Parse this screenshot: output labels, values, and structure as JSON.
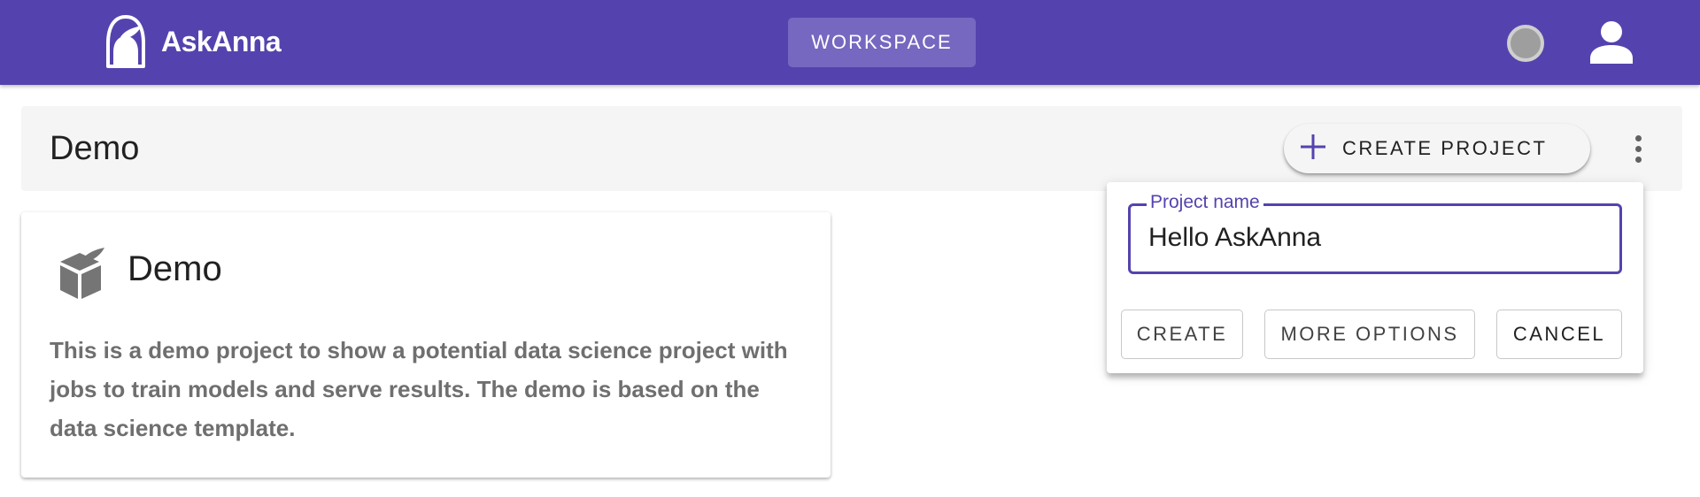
{
  "appbar": {
    "brand_name": "AskAnna",
    "workspace_label": "WORKSPACE",
    "logo_icon": "askanna-logo-icon",
    "status_icon": "status-circle-icon",
    "user_icon": "account-icon",
    "colors": {
      "primary": "#5443ae",
      "workspace_button": "#7668c0"
    }
  },
  "toolbar": {
    "title": "Demo",
    "create_project_label": "CREATE PROJECT",
    "create_icon": "plus-icon",
    "menu_icon": "dots-vertical-icon"
  },
  "project_card": {
    "icon": "cube-icon",
    "title": "Demo",
    "description": "This is a demo project to show a potential data science project with jobs to train models and serve results. The demo is based on the data science template."
  },
  "create_menu": {
    "field_label": "Project name",
    "field_value": "Hello AskAnna",
    "buttons": {
      "create": "CREATE",
      "more_options": "MORE OPTIONS",
      "cancel": "CANCEL"
    }
  }
}
